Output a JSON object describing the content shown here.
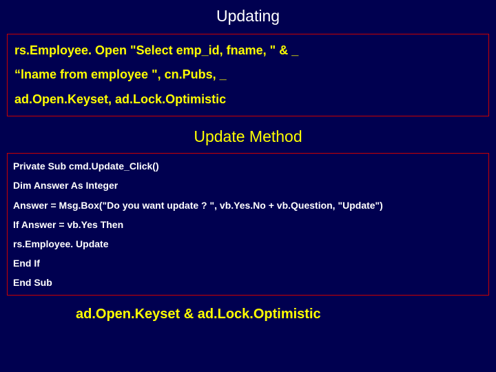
{
  "title": "Updating",
  "box1": {
    "line1": "rs.Employee. Open \"Select emp_id, fname, \" & _",
    "line2": "“lname from employee \", cn.Pubs, _",
    "line3": "ad.Open.Keyset, ad.Lock.Optimistic"
  },
  "subtitle": "Update Method",
  "box2": {
    "line1": "Private Sub cmd.Update_Click()",
    "line2": "Dim Answer As Integer",
    "line3": "Answer = Msg.Box(\"Do you want update ? \", vb.Yes.No + vb.Question, \"Update\")",
    "line4": "If Answer = vb.Yes Then",
    "line5": "rs.Employee. Update",
    "line6": "End If",
    "line7": "End Sub"
  },
  "footer": "ad.Open.Keyset & ad.Lock.Optimistic"
}
